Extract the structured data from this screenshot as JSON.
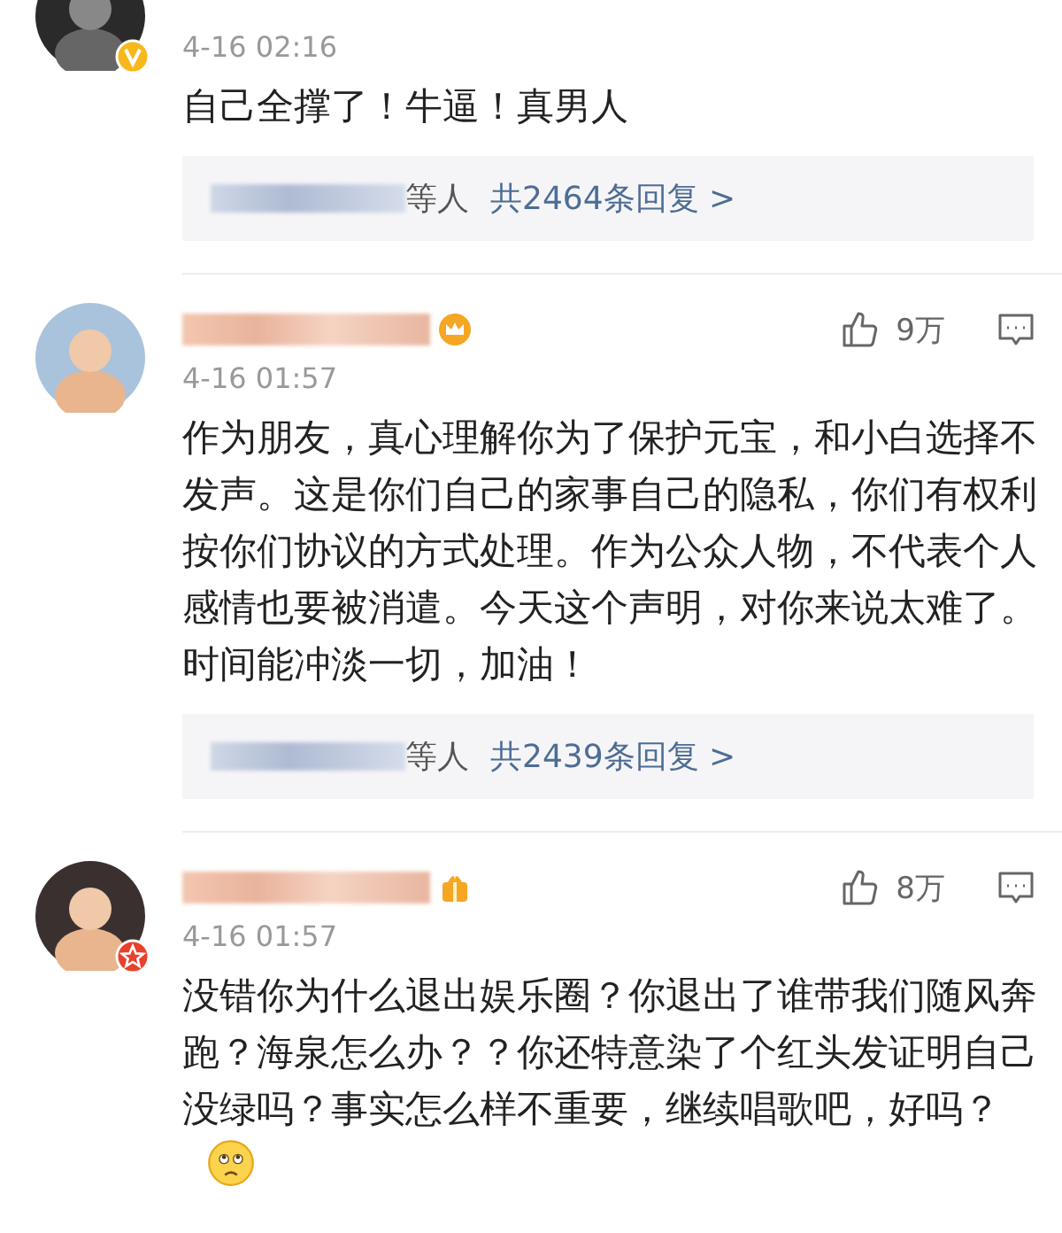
{
  "comments": [
    {
      "badge": {
        "kind": "verified"
      },
      "date": "4-16 02:16",
      "text": "自己全撑了！牛逼！真男人",
      "reply": {
        "others": "等人",
        "count": "共2464条回复 >"
      }
    },
    {
      "name_icon": {
        "kind": "crown"
      },
      "date": "4-16 01:57",
      "likes": "9万",
      "text": "作为朋友，真心理解你为了保护元宝，和小白选择不发声。这是你们自己的家事自己的隐私，你们有权利按你们协议的方式处理。作为公众人物，不代表个人感情也要被消遣。今天这个声明，对你来说太难了。时间能冲淡一切，加油！",
      "reply": {
        "others": "等人",
        "count": "共2439条回复 >"
      }
    },
    {
      "badge": {
        "kind": "star"
      },
      "name_icon": {
        "kind": "gift"
      },
      "date": "4-16 01:57",
      "likes": "8万",
      "text": "没错你为什么退出娱乐圈？你退出了谁带我们随风奔跑？海泉怎么办？？你还特意染了个红头发证明自己没绿吗？事实怎么样不重要，继续唱歌吧，好吗？",
      "emoji": {
        "kind": "sad"
      }
    }
  ]
}
